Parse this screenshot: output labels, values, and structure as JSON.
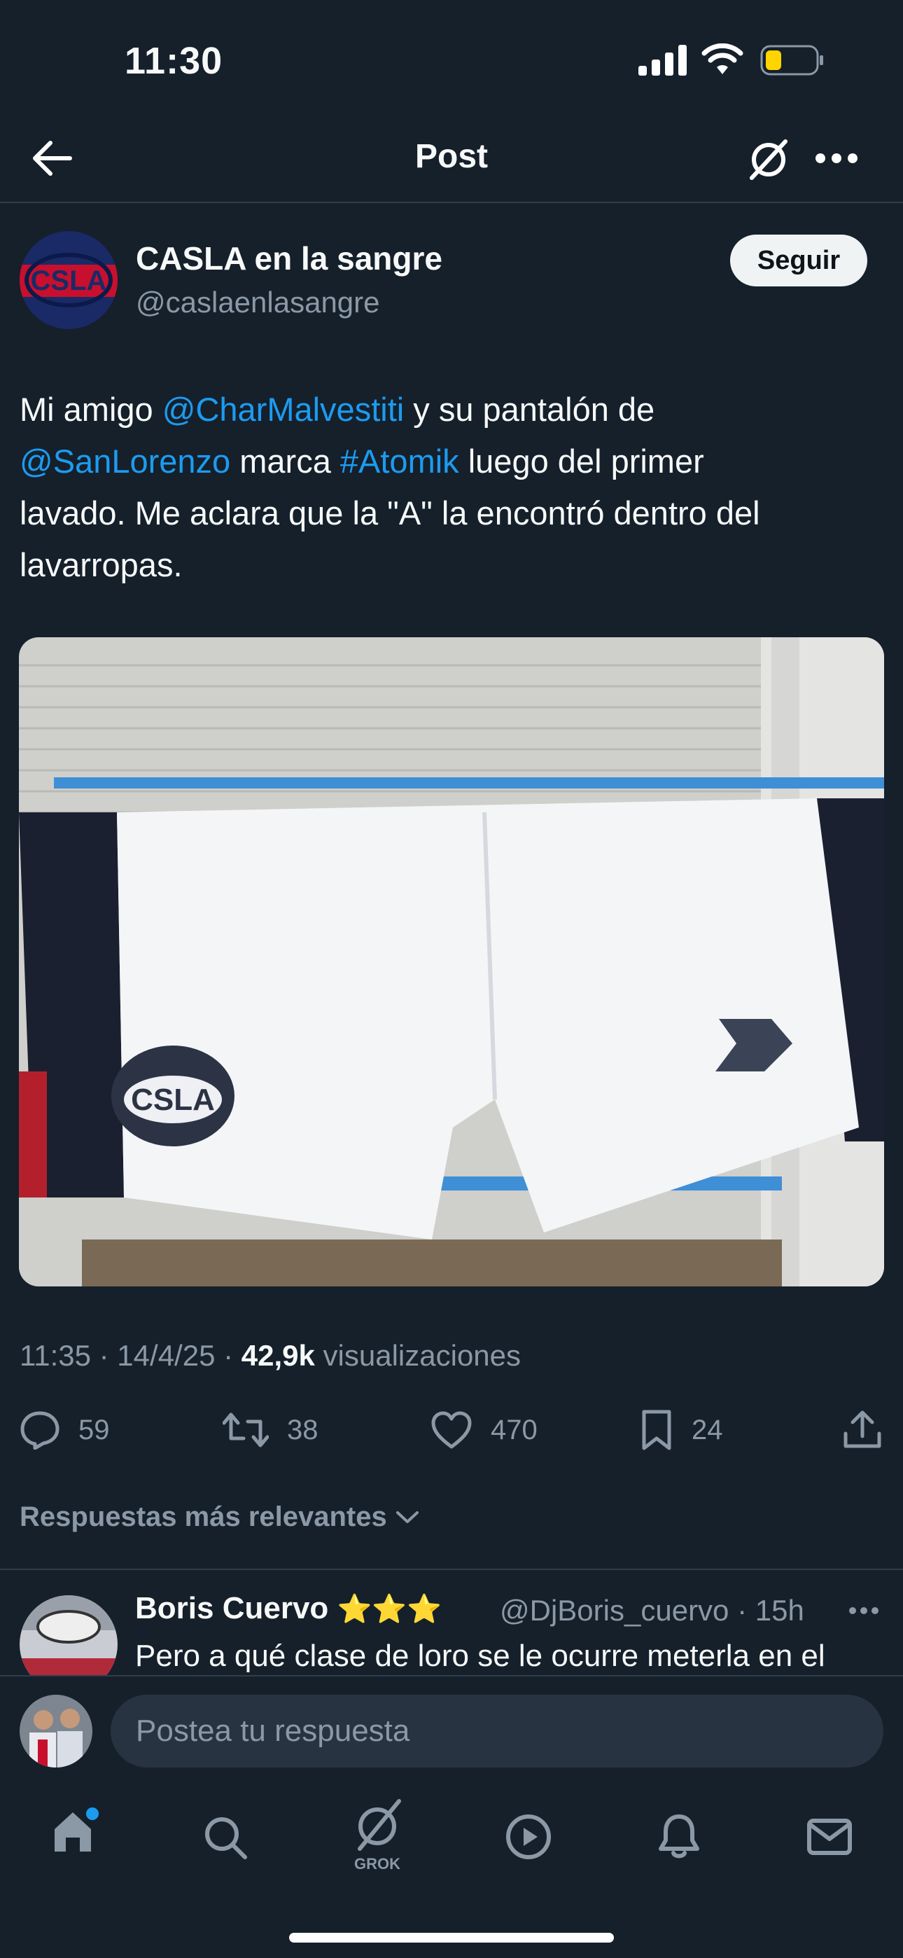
{
  "status_bar": {
    "time": "11:30"
  },
  "header": {
    "title": "Post"
  },
  "author": {
    "name": "CASLA en la sangre",
    "handle": "@caslaenlasangre",
    "follow_label": "Seguir"
  },
  "tweet": {
    "t1": "Mi amigo ",
    "mention1": "@CharMalvestiti",
    "t2": " y su pantalón de",
    "mention2": "@SanLorenzo",
    "t3": " marca ",
    "hashtag": "#Atomik",
    "t4": " luego del primer",
    "line3": "lavado. Me aclara que la \"A\" la encontró dentro del",
    "line4": "lavarropas."
  },
  "meta": {
    "time_date": "11:35 · 14/4/25 · ",
    "views": "42,9k",
    "views_label": " visualizaciones"
  },
  "actions": {
    "replies": "59",
    "reposts": "38",
    "likes": "470",
    "bookmarks": "24"
  },
  "replies_filter": "Respuestas más relevantes",
  "reply": {
    "name": "Boris Cuervo",
    "stars": "⭐⭐⭐",
    "handle_time": "@DjBoris_cuervo · 15h",
    "text": "Pero a qué clase de loro se le ocurre meterla en el"
  },
  "compose": {
    "placeholder": "Postea tu respuesta"
  },
  "nav": {
    "grok_label": "GROK"
  },
  "colors": {
    "background": "#15202b",
    "accent": "#1d9bf0",
    "muted": "#8b98a5"
  }
}
